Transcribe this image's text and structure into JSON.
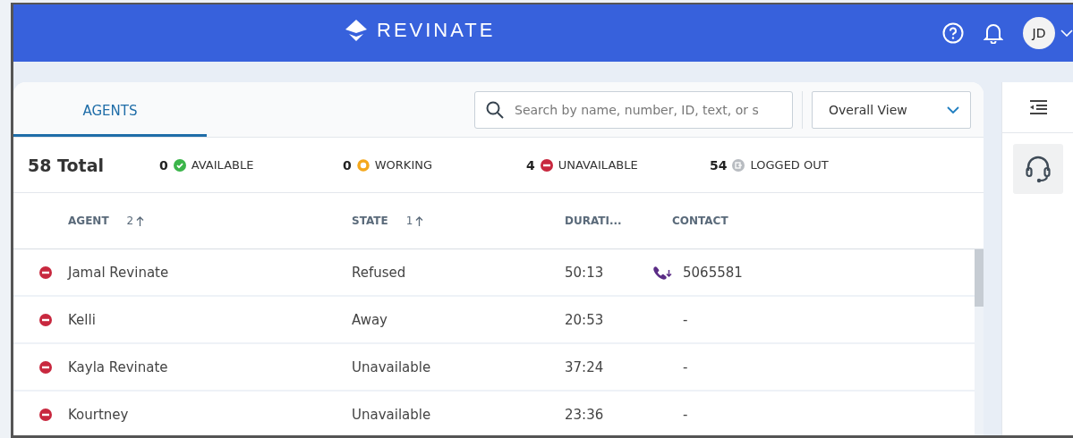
{
  "header": {
    "brand": "REVINATE",
    "user_initials": "JD"
  },
  "tabs": [
    {
      "label": "AGENTS",
      "selected": true
    }
  ],
  "search": {
    "placeholder": "Search by name, number, ID, text, or s"
  },
  "view_select": {
    "value": "Overall View"
  },
  "summary": {
    "total": "58 Total",
    "counts": [
      {
        "kind": "available",
        "count": "0",
        "label": "AVAILABLE"
      },
      {
        "kind": "working",
        "count": "0",
        "label": "WORKING"
      },
      {
        "kind": "unavailable",
        "count": "4",
        "label": "UNAVAILABLE"
      },
      {
        "kind": "logged_out",
        "count": "54",
        "label": "LOGGED OUT"
      }
    ]
  },
  "table": {
    "columns": [
      {
        "label": "AGENT",
        "sort_order": "2",
        "sort_ascending": true
      },
      {
        "label": "STATE",
        "sort_order": "1",
        "sort_ascending": true
      },
      {
        "label": "DURATI..."
      },
      {
        "label": "CONTACT"
      }
    ],
    "rows": [
      {
        "color": "#c8283f",
        "agent": "Jamal Revinate",
        "state": "Refused",
        "duration": "50:13",
        "incoming_call": true,
        "contact": "5065581"
      },
      {
        "color": "#c8283f",
        "agent": "Kelli",
        "state": "Away",
        "duration": "20:53",
        "incoming_call": false,
        "contact": "-"
      },
      {
        "color": "#c8283f",
        "agent": "Kayla Revinate",
        "state": "Unavailable",
        "duration": "37:24",
        "incoming_call": false,
        "contact": "-"
      },
      {
        "color": "#c8283f",
        "agent": "Kourtney",
        "state": "Unavailable",
        "duration": "23:36",
        "incoming_call": false,
        "contact": "-"
      }
    ]
  }
}
